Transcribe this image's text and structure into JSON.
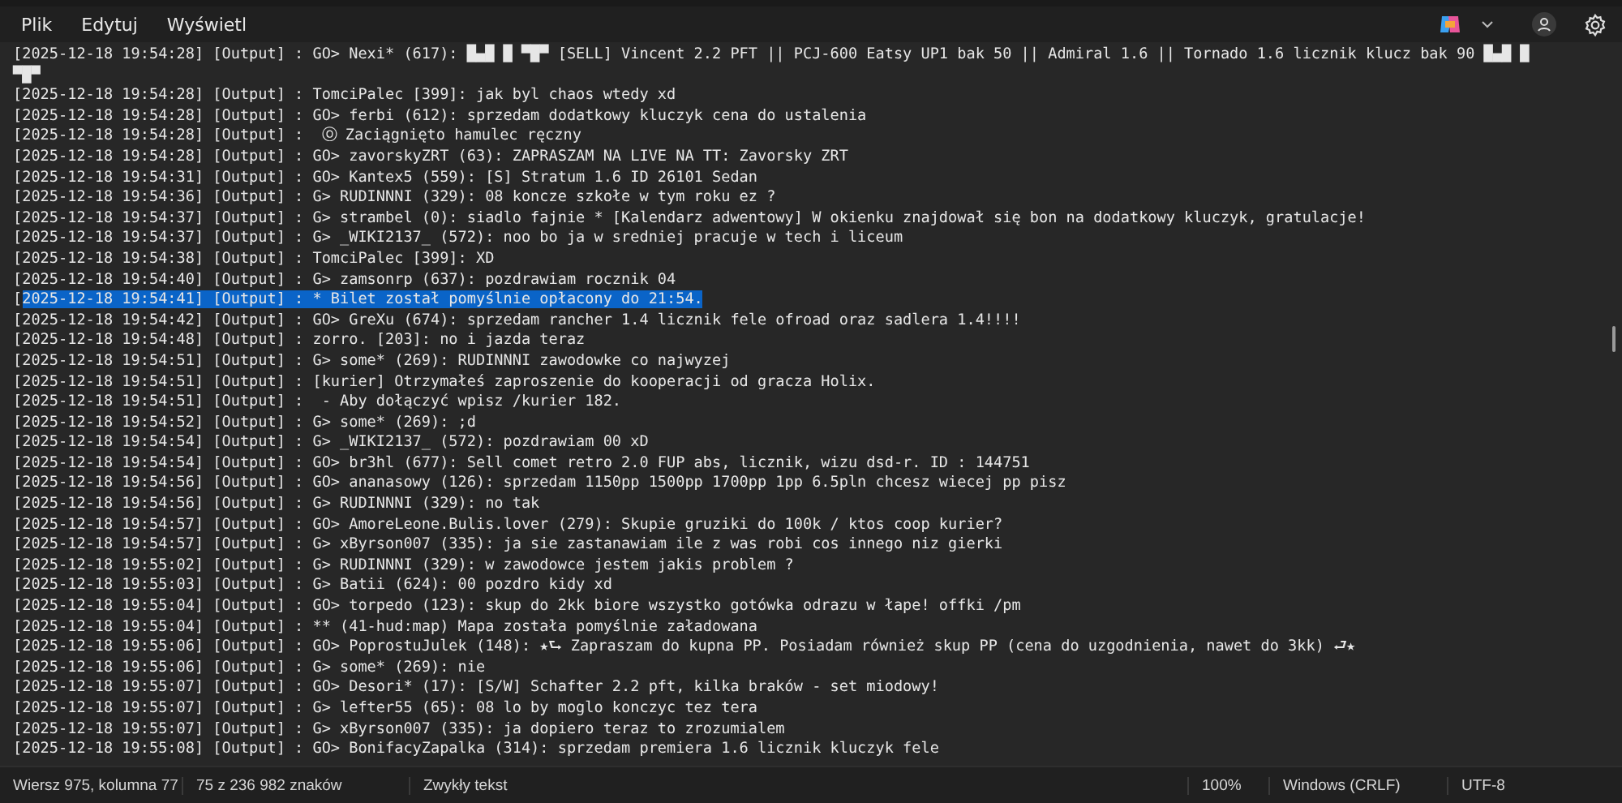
{
  "menu": [
    {
      "label": "Plik"
    },
    {
      "label": "Edytuj"
    },
    {
      "label": "Wyświetl"
    }
  ],
  "lines": [
    {
      "text": "[2025-12-18 19:54:28] [Output] : GO> Nexi* (617): █▄█ █ ▀█▀ [SELL] Vincent 2.2 PFT || PCJ-600 Eatsy UP1 bak 50 || Admiral 1.6 || Tornado 1.6 licznik klucz bak 90 █▄█ █\n▀█▀",
      "selected": false
    },
    {
      "text": "[2025-12-18 19:54:28] [Output] : TomciPalec [399]: jak byl chaos wtedy xd",
      "selected": false
    },
    {
      "text": "[2025-12-18 19:54:28] [Output] : GO> ferbi (612): sprzedam dodatkowy kluczyk cena do ustalenia",
      "selected": false
    },
    {
      "text": "[2025-12-18 19:54:28] [Output] :  ⓞ Zaciągnięto hamulec ręczny",
      "selected": false
    },
    {
      "text": "[2025-12-18 19:54:28] [Output] : GO> zavorskyZRT (63): ZAPRASZAM NA LIVE NA TT: Zavorsky ZRT",
      "selected": false
    },
    {
      "text": "[2025-12-18 19:54:31] [Output] : GO> Kantex5 (559): [S] Stratum 1.6 ID 26101 Sedan",
      "selected": false
    },
    {
      "text": "[2025-12-18 19:54:36] [Output] : G> RUDINNNI (329): 08 koncze szkołe w tym roku ez ?",
      "selected": false
    },
    {
      "text": "[2025-12-18 19:54:37] [Output] : G> strambel (0): siadlo fajnie * [Kalendarz adwentowy] W okienku znajdował się bon na dodatkowy kluczyk, gratulacje!",
      "selected": false
    },
    {
      "text": "[2025-12-18 19:54:37] [Output] : G> _WIKI2137_ (572): noo bo ja w sredniej pracuje w tech i liceum",
      "selected": false
    },
    {
      "text": "[2025-12-18 19:54:38] [Output] : TomciPalec [399]: XD",
      "selected": false
    },
    {
      "text": "[2025-12-18 19:54:40] [Output] : G> zamsonrp (637): pozdrawiam rocznik 04",
      "selected": false
    },
    {
      "text": "[2025-12-18 19:54:41] [Output] : * Bilet został pomyślnie opłacony do 21:54.",
      "selected": true
    },
    {
      "text": "[2025-12-18 19:54:42] [Output] : GO> GreXu (674): sprzedam rancher 1.4 licznik fele ofroad oraz sadlera 1.4!!!!",
      "selected": false
    },
    {
      "text": "[2025-12-18 19:54:48] [Output] : zorro. [203]: no i jazda teraz",
      "selected": false
    },
    {
      "text": "[2025-12-18 19:54:51] [Output] : G> some* (269): RUDINNNI zawodowke co najwyzej",
      "selected": false
    },
    {
      "text": "[2025-12-18 19:54:51] [Output] : [kurier] Otrzymałeś zaproszenie do kooperacji od gracza Holix.",
      "selected": false
    },
    {
      "text": "[2025-12-18 19:54:51] [Output] :  - Aby dołączyć wpisz /kurier 182.",
      "selected": false
    },
    {
      "text": "[2025-12-18 19:54:52] [Output] : G> some* (269): ;d",
      "selected": false
    },
    {
      "text": "[2025-12-18 19:54:54] [Output] : G> _WIKI2137_ (572): pozdrawiam 00 xD",
      "selected": false
    },
    {
      "text": "[2025-12-18 19:54:54] [Output] : GO> br3hl (677): Sell comet retro 2.0 FUP abs, licznik, wizu dsd-r. ID : 144751",
      "selected": false
    },
    {
      "text": "[2025-12-18 19:54:56] [Output] : GO> ananasowy (126): sprzedam 1150pp 1500pp 1700pp 1pp 6.5pln chcesz wiecej pp pisz",
      "selected": false
    },
    {
      "text": "[2025-12-18 19:54:56] [Output] : G> RUDINNNI (329): no tak",
      "selected": false
    },
    {
      "text": "[2025-12-18 19:54:57] [Output] : GO> AmoreLeone.Bulis.lover (279): Skupie gruziki do 100k / ktos coop kurier?",
      "selected": false
    },
    {
      "text": "[2025-12-18 19:54:57] [Output] : G> xByrson007 (335): ja sie zastanawiam ile z was robi cos innego niz gierki",
      "selected": false
    },
    {
      "text": "[2025-12-18 19:55:02] [Output] : G> RUDINNNI (329): w zawodowce jestem jakis problem ?",
      "selected": false
    },
    {
      "text": "[2025-12-18 19:55:03] [Output] : G> Batii (624): 00 pozdro kidy xd",
      "selected": false
    },
    {
      "text": "[2025-12-18 19:55:04] [Output] : GO> torpedo (123): skup do 2kk biore wszystko gotówka odrazu w łape! offki /pm",
      "selected": false
    },
    {
      "text": "[2025-12-18 19:55:04] [Output] : ** (41-hud:map) Mapa została pomyślnie załadowana",
      "selected": false
    },
    {
      "text": "[2025-12-18 19:55:06] [Output] : GO> PoprostuJulek (148): ★⮑ Zapraszam do kupna PP. Posiadam również skup PP (cena do uzgodnienia, nawet do 3kk) ⮐★",
      "selected": false
    },
    {
      "text": "[2025-12-18 19:55:06] [Output] : G> some* (269): nie",
      "selected": false
    },
    {
      "text": "[2025-12-18 19:55:07] [Output] : GO> Desori* (17): [S/W] Schafter 2.2 pft, kilka braków - set miodowy!",
      "selected": false
    },
    {
      "text": "[2025-12-18 19:55:07] [Output] : G> lefter55 (65): 08 lo by moglo konczyc tez tera",
      "selected": false
    },
    {
      "text": "[2025-12-18 19:55:07] [Output] : G> xByrson007 (335): ja dopiero teraz to zrozumialem",
      "selected": false
    },
    {
      "text": "[2025-12-18 19:55:08] [Output] : GO> BonifacyZapalka (314): sprzedam premiera 1.6 licznik kluczyk fele",
      "selected": false
    }
  ],
  "status_bar": {
    "position": "Wiersz 975, kolumna 77",
    "selection": "75 z 236 982 znaków",
    "format": "Zwykły tekst",
    "zoom": "100%",
    "line_ending": "Windows (CRLF)",
    "encoding": "UTF-8"
  }
}
